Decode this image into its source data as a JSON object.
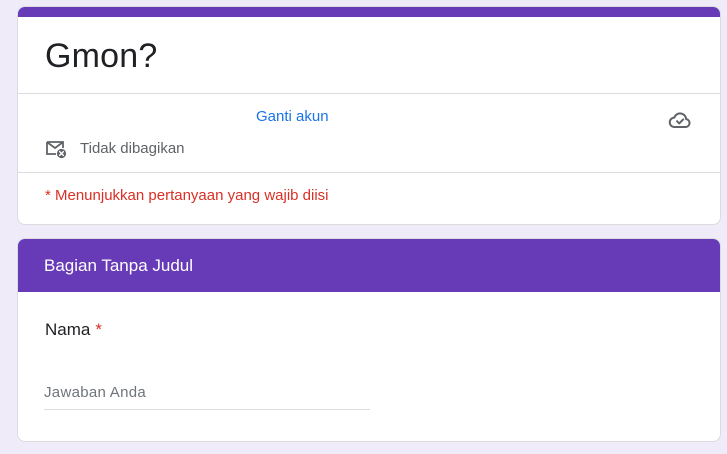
{
  "form": {
    "title": "Gmon?",
    "switch_account_label": "Ganti akun",
    "not_shared_label": "Tidak dibagikan",
    "required_note": "* Menunjukkan pertanyaan yang wajib diisi",
    "cloud_icon": "cloud-check-icon",
    "mail_icon": "mail-off-icon"
  },
  "section": {
    "title": "Bagian Tanpa Judul",
    "question": {
      "label": "Nama",
      "required_marker": "*",
      "placeholder": "Jawaban Anda",
      "value": ""
    }
  },
  "colors": {
    "accent": "#673ab7",
    "background": "#efebf8",
    "required": "#d93025",
    "link": "#1a73e8"
  }
}
